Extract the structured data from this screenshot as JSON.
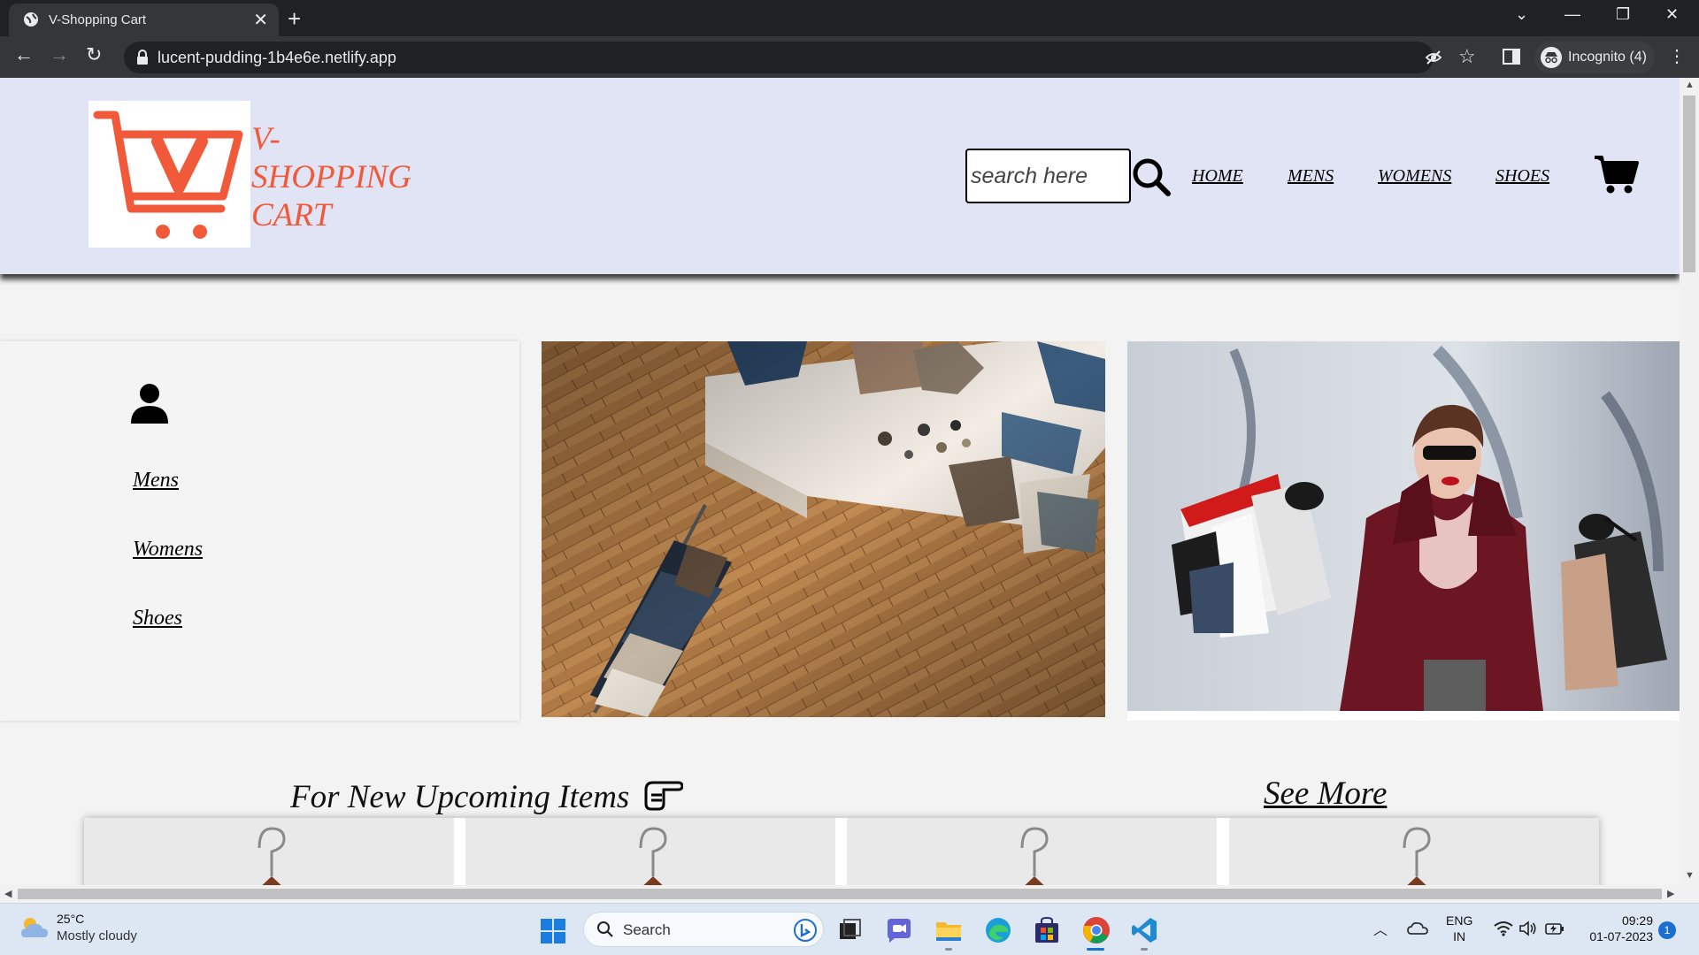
{
  "browser": {
    "tab_title": "V-Shopping Cart",
    "url": "lucent-pudding-1b4e6e.netlify.app",
    "profile_label": "Incognito (4)"
  },
  "site": {
    "brand": "V-\nSHOPPING\nCART",
    "brand_color": "#f05a3a",
    "header_bg": "#e1e4f4",
    "search_placeholder": "search here",
    "nav": [
      "HOME",
      "MENS",
      "WOMENS",
      "SHOES"
    ],
    "side_links": [
      "Mens",
      "Womens",
      "Shoes"
    ],
    "upcoming_heading": "For New Upcoming Items",
    "see_more": "See More",
    "item_cards": 4
  },
  "taskbar": {
    "weather_temp": "25°C",
    "weather_desc": "Mostly cloudy",
    "search_label": "Search",
    "lang_line1": "ENG",
    "lang_line2": "IN",
    "time": "09:29",
    "date": "01-07-2023",
    "notification_count": "1"
  }
}
